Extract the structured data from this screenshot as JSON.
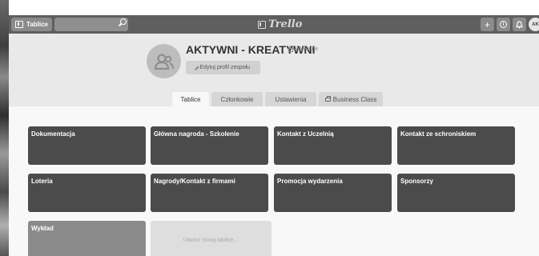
{
  "header": {
    "boards_label": "Tablice",
    "search_value": "",
    "logo_text": "Trello",
    "add_glyph": "+",
    "info_glyph": "i",
    "bell_glyph": "",
    "avatar_initials": "AK"
  },
  "team": {
    "name": "AKTYWNI - KREATYWNI",
    "visibility": "Prywatne",
    "edit_label": "Edytuj profil zespołu"
  },
  "tabs": [
    {
      "label": "Tablice",
      "active": true
    },
    {
      "label": "Członkowie",
      "active": false
    },
    {
      "label": "Ustawienia",
      "active": false
    },
    {
      "label": "Business Class",
      "active": false
    }
  ],
  "boards": [
    {
      "title": "Dokumentacja"
    },
    {
      "title": "Główna nagroda - Szkolenie"
    },
    {
      "title": "Kontakt z Uczelnią"
    },
    {
      "title": "Kontakt ze schroniskiem"
    },
    {
      "title": "Loteria"
    },
    {
      "title": "Nagrody/Kontakt z firmami"
    },
    {
      "title": "Promocja wydarzenia"
    },
    {
      "title": "Sponsorzy"
    },
    {
      "title": "Wykład"
    }
  ],
  "create_board_label": "Utwórz nową tablicę…",
  "colors": {
    "header_bg": "#5f5f5f",
    "tile_bg": "#4b4b4b",
    "tile_light_bg": "#8a8a8a",
    "page_bg": "#e9e9e9",
    "content_bg": "#f8f8f8"
  }
}
